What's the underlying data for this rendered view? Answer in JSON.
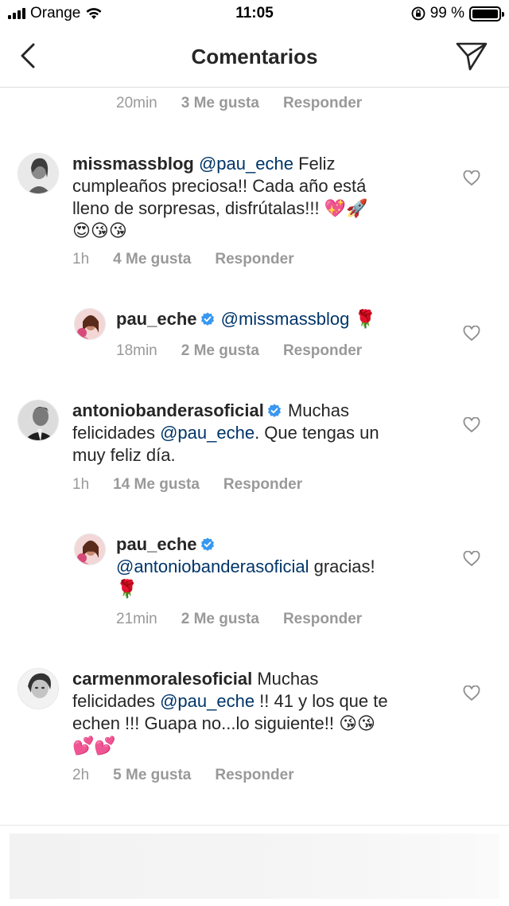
{
  "status": {
    "carrier": "Orange",
    "time": "11:05",
    "battery": "99 %",
    "battery_level": 0.99
  },
  "header": {
    "title": "Comentarios"
  },
  "top_meta": {
    "time": "20min",
    "likes": "3 Me gusta",
    "reply": "Responder"
  },
  "comments": [
    {
      "user": "missmassblog",
      "mention": "@pau_eche",
      "text_line1_after": " Feliz",
      "line2": "cumpleaños preciosa!! Cada año está",
      "line3": "lleno de sorpresas, disfrútalas!!! ",
      "line3_emojis": "💖🚀",
      "line4_emojis": "😍😘😘",
      "time": "1h",
      "likes": "4 Me gusta",
      "reply": "Responder"
    },
    {
      "user": "pau_eche",
      "mention": "@missmassblog",
      "emoji": "🌹",
      "time": "18min",
      "likes": "2 Me gusta",
      "reply": "Responder"
    },
    {
      "user": "antoniobanderasoficial",
      "text_line1_after": "Muchas",
      "line2_before": "felicidades ",
      "mention": "@pau_eche",
      "line2_after": ". Que tengas un",
      "line3": "muy feliz día.",
      "time": "1h",
      "likes": "14 Me gusta",
      "reply": "Responder"
    },
    {
      "user": "pau_eche",
      "mention": "@antoniobanderasoficial",
      "text_after": " gracias!",
      "emoji": "🌹",
      "time": "21min",
      "likes": "2 Me gusta",
      "reply": "Responder"
    },
    {
      "user": "carmenmoralesoficial",
      "text_line1_after": " Muchas",
      "line2_before": "felicidades ",
      "mention": "@pau_eche",
      "line2_after": " !! 41 y los que te",
      "line3": "echen !!! Guapa no...lo siguiente!! ",
      "line3_emojis": "😘😘",
      "line4_emojis": "💕💕",
      "time": "2h",
      "likes": "5 Me gusta",
      "reply": "Responder"
    }
  ],
  "icons": {
    "back": "chevron-left-icon",
    "send": "paper-plane-icon",
    "like": "heart-outline-icon",
    "verified": "verified-badge-icon",
    "wifi": "wifi-icon",
    "signal": "signal-bars-icon",
    "rotation_lock": "rotation-lock-icon",
    "battery": "battery-icon"
  },
  "colors": {
    "mention": "#003569",
    "meta_text": "#999999",
    "verified": "#3897f0",
    "divider": "#dbdbdb"
  }
}
